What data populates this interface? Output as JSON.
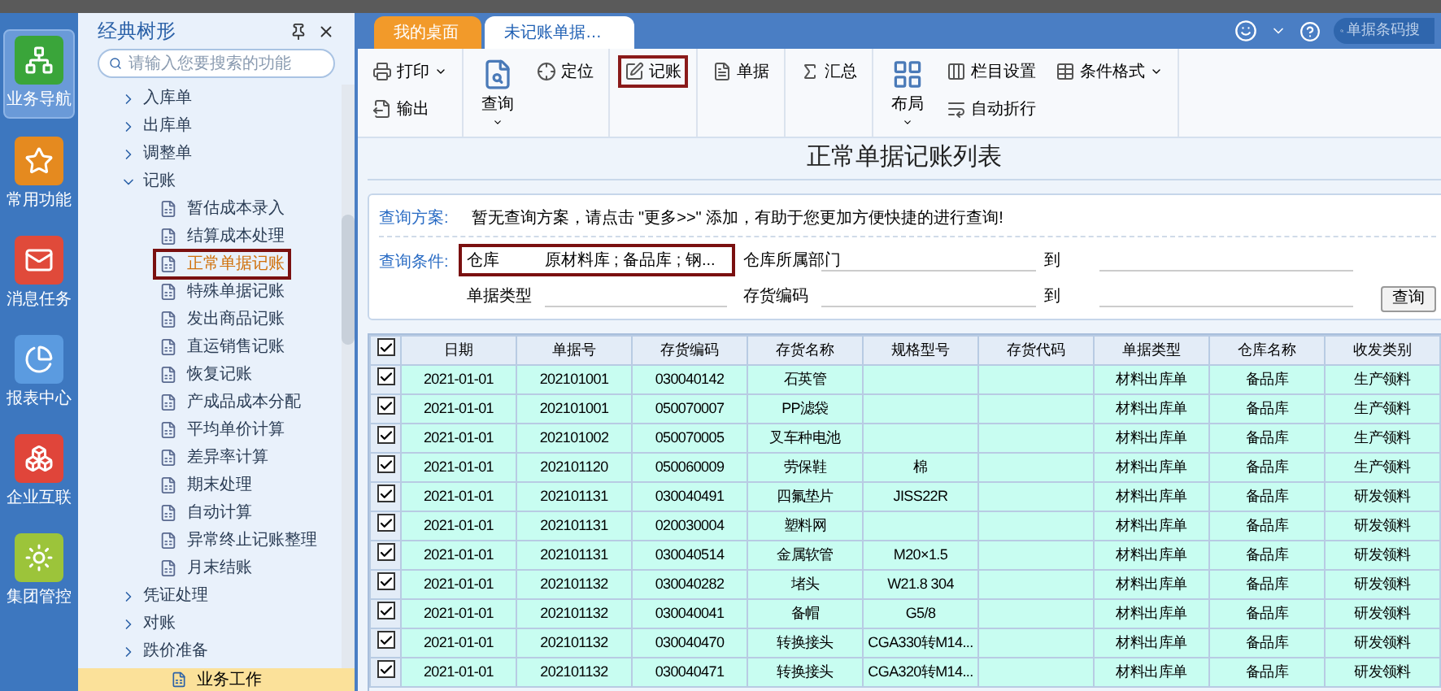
{
  "rail": [
    {
      "label": "业务导航",
      "selected": true
    },
    {
      "label": "常用功能",
      "selected": false
    },
    {
      "label": "消息任务",
      "selected": false
    },
    {
      "label": "报表中心",
      "selected": false
    },
    {
      "label": "企业互联",
      "selected": false
    },
    {
      "label": "集团管控",
      "selected": false
    }
  ],
  "tree": {
    "title": "经典树形",
    "search_placeholder": "请输入您要搜索的功能",
    "items": [
      {
        "label": "入库单",
        "expanded": false
      },
      {
        "label": "出库单",
        "expanded": false
      },
      {
        "label": "调整单",
        "expanded": false
      },
      {
        "label": "记账",
        "expanded": true,
        "children": [
          {
            "label": "暂估成本录入",
            "selected": false
          },
          {
            "label": "结算成本处理",
            "selected": false
          },
          {
            "label": "正常单据记账",
            "selected": true
          },
          {
            "label": "特殊单据记账",
            "selected": false
          },
          {
            "label": "发出商品记账",
            "selected": false
          },
          {
            "label": "直运销售记账",
            "selected": false
          },
          {
            "label": "恢复记账",
            "selected": false
          },
          {
            "label": "产成品成本分配",
            "selected": false
          },
          {
            "label": "平均单价计算",
            "selected": false
          },
          {
            "label": "差异率计算",
            "selected": false
          },
          {
            "label": "期末处理",
            "selected": false
          },
          {
            "label": "自动计算",
            "selected": false
          },
          {
            "label": "异常终止记账整理",
            "selected": false
          },
          {
            "label": "月末结账",
            "selected": false
          }
        ]
      },
      {
        "label": "凭证处理",
        "expanded": false
      },
      {
        "label": "对账",
        "expanded": false
      },
      {
        "label": "跌价准备",
        "expanded": false
      }
    ],
    "bottom_tab": "业务工作"
  },
  "tabs": [
    {
      "label": "我的桌面",
      "selected": false
    },
    {
      "label": "未记账单据…",
      "selected": true
    }
  ],
  "search_placeholder": "单据条码搜",
  "toolbar": [
    {
      "buttons": [
        {
          "label": "打印",
          "kind": "small",
          "dropdown": true,
          "highlighted": false
        },
        {
          "label": "输出",
          "kind": "small",
          "dropdown": false,
          "highlighted": false
        }
      ]
    },
    {
      "buttons": [
        {
          "label": "查询",
          "kind": "large",
          "dropdown": true,
          "highlighted": false
        },
        {
          "label": "定位",
          "kind": "small",
          "dropdown": false,
          "highlighted": false
        }
      ]
    },
    {
      "buttons": [
        {
          "label": "记账",
          "kind": "small",
          "dropdown": false,
          "highlighted": true
        }
      ]
    },
    {
      "buttons": [
        {
          "label": "单据",
          "kind": "small",
          "dropdown": false,
          "highlighted": false
        }
      ]
    },
    {
      "buttons": [
        {
          "label": "汇总",
          "kind": "small",
          "dropdown": false,
          "highlighted": false
        }
      ]
    },
    {
      "buttons": [
        {
          "label": "布局",
          "kind": "large",
          "dropdown": true,
          "highlighted": false
        },
        {
          "label": "栏目设置",
          "kind": "small",
          "dropdown": false,
          "highlighted": false
        },
        {
          "label": "自动折行",
          "kind": "small",
          "dropdown": false,
          "highlighted": false
        },
        {
          "label": "条件格式",
          "kind": "small",
          "dropdown": true,
          "highlighted": false
        }
      ]
    }
  ],
  "page_title": "正常单据记账列表",
  "query": {
    "scheme_label": "查询方案:",
    "scheme_text": "暂无查询方案，请点击 \"更多>>\" 添加，有助于您更加方便快捷的进行查询!",
    "condition_label": "查询条件:",
    "conditions": [
      {
        "label": "仓库",
        "value": "原材料库 ; 备品库 ; 钢...",
        "highlighted": true
      },
      {
        "label": "仓库所属部门",
        "to": true,
        "to_label": "到",
        "highlighted": false
      },
      {
        "label": "单据类型",
        "highlighted": false
      },
      {
        "label": "存货编码",
        "to": true,
        "to_label": "到",
        "highlighted": false
      }
    ],
    "button": "查询"
  },
  "table": {
    "all_checked": true,
    "columns": [
      "日期",
      "单据号",
      "存货编码",
      "存货名称",
      "规格型号",
      "存货代码",
      "单据类型",
      "仓库名称",
      "收发类别"
    ],
    "rows": [
      {
        "checked": true,
        "cells": [
          "2021-01-01",
          "202101001",
          "030040142",
          "石英管",
          "",
          "",
          "材料出库单",
          "备品库",
          "生产领料"
        ]
      },
      {
        "checked": true,
        "cells": [
          "2021-01-01",
          "202101001",
          "050070007",
          "PP滤袋",
          "",
          "",
          "材料出库单",
          "备品库",
          "生产领料"
        ]
      },
      {
        "checked": true,
        "cells": [
          "2021-01-01",
          "202101002",
          "050070005",
          "叉车种电池",
          "",
          "",
          "材料出库单",
          "备品库",
          "生产领料"
        ]
      },
      {
        "checked": true,
        "cells": [
          "2021-01-01",
          "202101120",
          "050060009",
          "劳保鞋",
          "棉",
          "",
          "材料出库单",
          "备品库",
          "生产领料"
        ]
      },
      {
        "checked": true,
        "cells": [
          "2021-01-01",
          "202101131",
          "030040491",
          "四氟垫片",
          "JISS22R",
          "",
          "材料出库单",
          "备品库",
          "研发领料"
        ]
      },
      {
        "checked": true,
        "cells": [
          "2021-01-01",
          "202101131",
          "020030004",
          "塑料网",
          "",
          "",
          "材料出库单",
          "备品库",
          "研发领料"
        ]
      },
      {
        "checked": true,
        "cells": [
          "2021-01-01",
          "202101131",
          "030040514",
          "金属软管",
          "M20×1.5",
          "",
          "材料出库单",
          "备品库",
          "研发领料"
        ]
      },
      {
        "checked": true,
        "cells": [
          "2021-01-01",
          "202101132",
          "030040282",
          "堵头",
          "W21.8 304",
          "",
          "材料出库单",
          "备品库",
          "研发领料"
        ]
      },
      {
        "checked": true,
        "cells": [
          "2021-01-01",
          "202101132",
          "030040041",
          "备帽",
          "G5/8",
          "",
          "材料出库单",
          "备品库",
          "研发领料"
        ]
      },
      {
        "checked": true,
        "cells": [
          "2021-01-01",
          "202101132",
          "030040470",
          "转换接头",
          "CGA330转M14...",
          "",
          "材料出库单",
          "备品库",
          "研发领料"
        ]
      },
      {
        "checked": true,
        "cells": [
          "2021-01-01",
          "202101132",
          "030040471",
          "转换接头",
          "CGA320转M14...",
          "",
          "材料出库单",
          "备品库",
          "研发领料"
        ]
      }
    ]
  }
}
